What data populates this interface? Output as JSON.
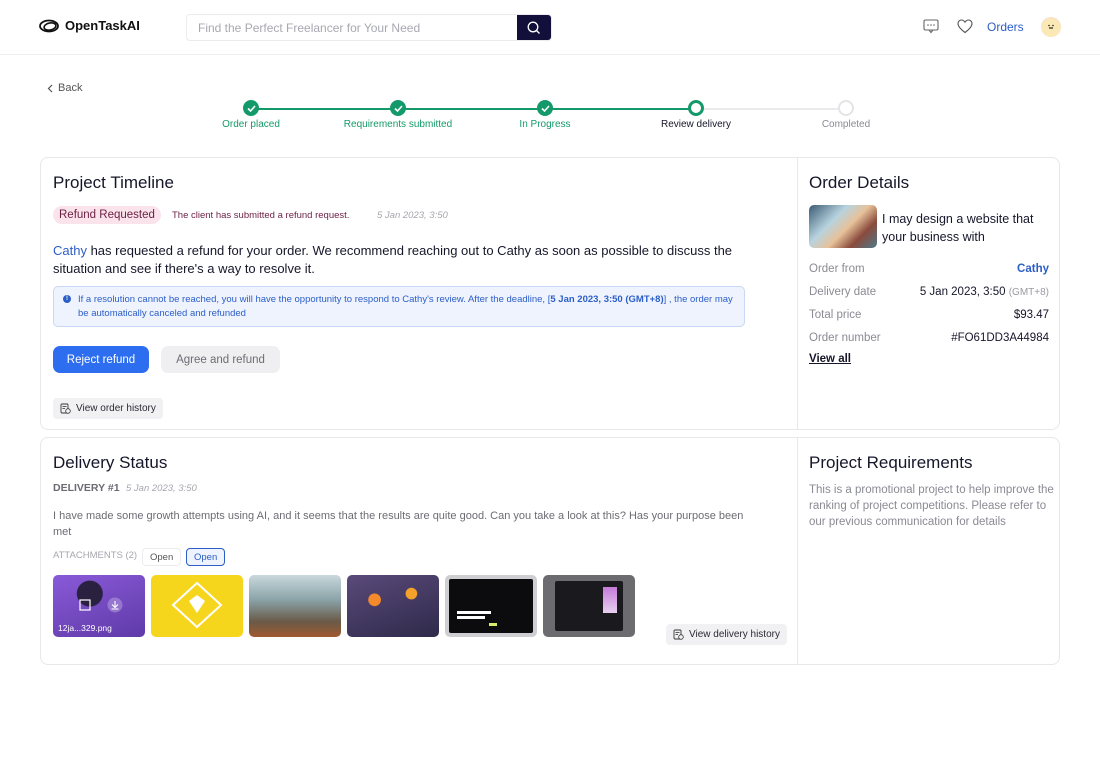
{
  "header": {
    "brand": "OpenTaskAI",
    "search_placeholder": "Find the Perfect Freelancer for Your Need",
    "search_value": "",
    "icons": [
      "message-icon",
      "heart-icon"
    ],
    "orders_label": "Orders"
  },
  "nav": {
    "back_label": "Back"
  },
  "stepper": {
    "steps": [
      {
        "label": "Order placed",
        "state": "done"
      },
      {
        "label": "Requirements submitted",
        "state": "done"
      },
      {
        "label": "In Progress",
        "state": "done"
      },
      {
        "label": "Review delivery",
        "state": "current"
      },
      {
        "label": "Completed",
        "state": "todo"
      }
    ],
    "colors": {
      "done": "#149a6a",
      "current_label": "#16162a",
      "todo": "#8a8a93"
    }
  },
  "timeline": {
    "title": "Project Timeline",
    "badge": "Refund Requested",
    "note": "The client has submitted a refund request.",
    "time": "5 Jan 2023, 3:50",
    "client_name": "Cathy",
    "message": " has requested a refund for your order. We recommend reaching out to Cathy as soon as possible to discuss the situation and see if there's a way to resolve it.",
    "info_prefix": "If a resolution cannot be reached, you will have the opportunity to respond to Cathy's review. After the deadline, [",
    "info_deadline": "5 Jan 2023, 3:50 (GMT+8)",
    "info_suffix": "] , the order may be automatically canceled and refunded",
    "reject_label": "Reject refund",
    "agree_label": "Agree and refund",
    "history_label": "View order history"
  },
  "order_details": {
    "title": "Order Details",
    "gig_title": "I may design a website that your business with",
    "rows": [
      {
        "label": "Order from",
        "value": "Cathy"
      },
      {
        "label": "Delivery date",
        "value": "5 Jan 2023, 3:50",
        "suffix": "(GMT+8)"
      },
      {
        "label": "Total price",
        "value": "$93.47"
      },
      {
        "label": "Order number",
        "value": "#FO61DD3A44984"
      }
    ],
    "view_all": "View all"
  },
  "delivery": {
    "title": "Delivery Status",
    "number": "DELIVERY #1",
    "time": "5 Jan 2023, 3:50",
    "message": "I have made some growth attempts using AI, and it seems that the results are quite good. Can you take a look at this? Has your purpose been met",
    "attachments_label": "ATTACHMENTS (2)",
    "open_labels": [
      "Open",
      "Open"
    ],
    "thumbnails": [
      {
        "name": "12ja...329.png"
      },
      {
        "name": ""
      },
      {
        "name": ""
      },
      {
        "name": ""
      },
      {
        "name": ""
      },
      {
        "name": ""
      }
    ],
    "history_label": "View delivery history"
  },
  "requirements": {
    "title": "Project Requirements",
    "text": "This is a promotional project to help improve the ranking of project competitions. Please refer to our previous communication for details"
  },
  "colors": {
    "accent": "#2d6ef0",
    "success": "#149a6a",
    "refund_badge_bg": "#fbe3ec",
    "search_button": "#12103a"
  }
}
